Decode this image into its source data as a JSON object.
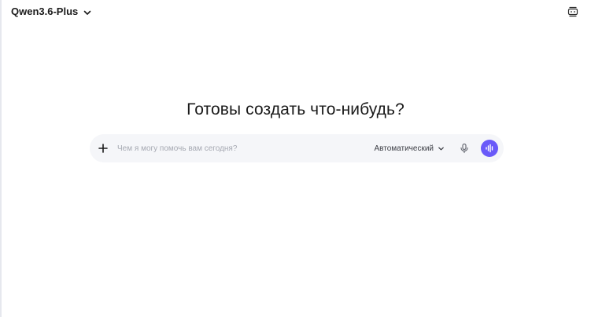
{
  "header": {
    "model_name": "Qwen3.6-Plus",
    "model_dropdown_icon": "chevron-down-icon",
    "temp_chat_icon": "temporary-chat-icon"
  },
  "main": {
    "title": "Готовы создать что-нибудь?"
  },
  "composer": {
    "plus_icon": "plus-icon",
    "placeholder": "Чем я могу помочь вам сегодня?",
    "value": "",
    "mode_label": "Автоматический",
    "mode_icon": "chevron-down-icon",
    "mic_icon": "microphone-icon",
    "voice_icon": "voice-wave-icon"
  },
  "colors": {
    "accent": "#6a5af9",
    "composer_bg": "#f5f6f9",
    "placeholder": "#a6a9b2"
  }
}
